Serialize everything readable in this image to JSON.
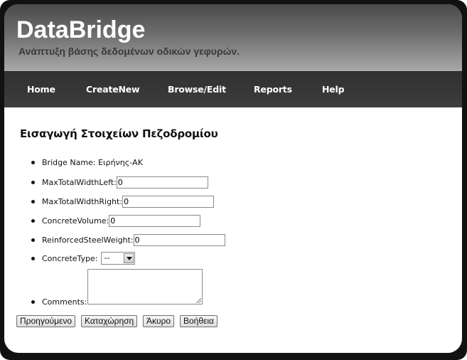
{
  "header": {
    "title": "DataBridge",
    "tagline": "Ανάπτυξη βάσης δεδομένων οδικών γεφυρών."
  },
  "nav": {
    "items": [
      {
        "label": "Home"
      },
      {
        "label": "CreateNew"
      },
      {
        "label": "Browse/Edit"
      },
      {
        "label": "Reports"
      },
      {
        "label": "Help"
      }
    ]
  },
  "form": {
    "title": "Εισαγωγή Στοιχείων Πεζοδρομίου",
    "bridge_name_label": "Bridge Name: Ειρήνης-ΑΚ",
    "fields": {
      "max_total_width_left": {
        "label": "MaxTotalWidthLeft:",
        "value": "0"
      },
      "max_total_width_right": {
        "label": "MaxTotalWidthRight:",
        "value": "0"
      },
      "concrete_volume": {
        "label": "ConcreteVolume:",
        "value": "0"
      },
      "reinforced_steel_weight": {
        "label": "ReinforcedSteelWeight:",
        "value": "0"
      }
    },
    "concrete_type": {
      "label": "ConcreteType:",
      "selected": "--"
    },
    "comments": {
      "label": "Comments:",
      "value": ""
    },
    "buttons": {
      "previous": "Προηγούμενο",
      "submit": "Καταχώρηση",
      "cancel": "Άκυρο",
      "help": "Βοήθεια"
    }
  }
}
